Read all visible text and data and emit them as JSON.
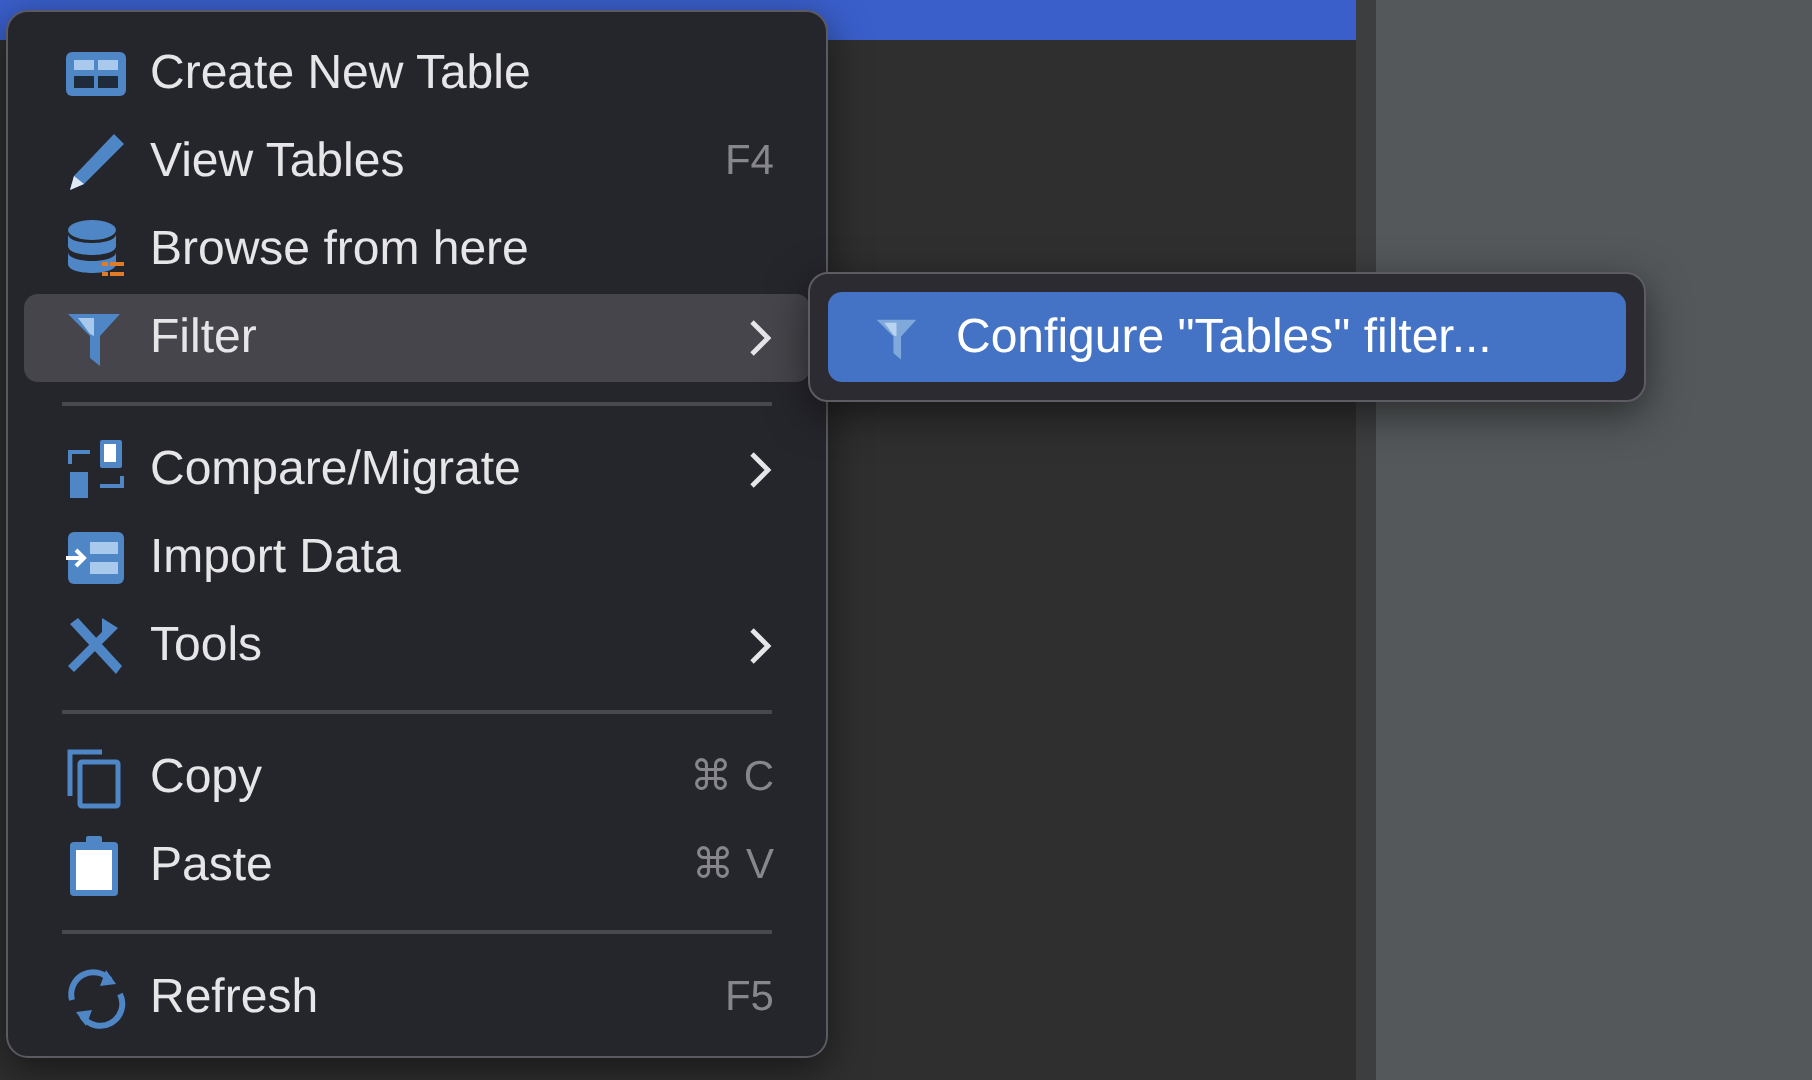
{
  "menu": {
    "items": [
      {
        "kind": "item",
        "label": "Create New Table",
        "submenu": false,
        "selected": false
      },
      {
        "kind": "item",
        "label": "View Tables",
        "shortcut": "F4",
        "submenu": false,
        "selected": false
      },
      {
        "kind": "item",
        "label": "Browse from here",
        "submenu": false,
        "selected": false
      },
      {
        "kind": "item",
        "label": "Filter",
        "submenu": true,
        "selected": true
      },
      {
        "kind": "separator"
      },
      {
        "kind": "item",
        "label": "Compare/Migrate",
        "submenu": true,
        "selected": false
      },
      {
        "kind": "item",
        "label": "Import Data",
        "submenu": false,
        "selected": false
      },
      {
        "kind": "item",
        "label": "Tools",
        "submenu": true,
        "selected": false
      },
      {
        "kind": "separator"
      },
      {
        "kind": "item",
        "label": "Copy",
        "shortcut": "⌘ C",
        "submenu": false,
        "selected": false
      },
      {
        "kind": "item",
        "label": "Paste",
        "shortcut": "⌘ V",
        "submenu": false,
        "selected": false
      },
      {
        "kind": "separator"
      },
      {
        "kind": "item",
        "label": "Refresh",
        "shortcut": "F5",
        "submenu": false,
        "selected": false
      }
    ]
  },
  "submenu": {
    "items": [
      {
        "label": "Configure \"Tables\" filter...",
        "selected": true
      }
    ]
  }
}
